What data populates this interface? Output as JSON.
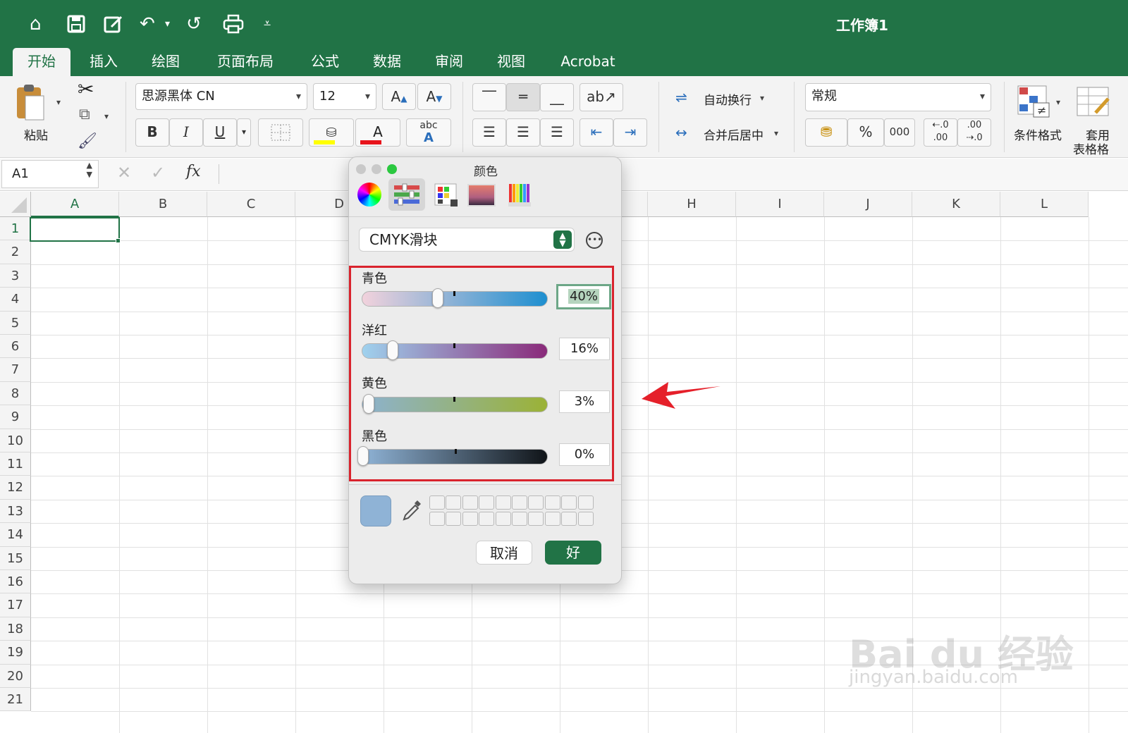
{
  "window": {
    "title": "工作簿1"
  },
  "quick_access": [
    "home-icon",
    "save-icon",
    "edit-save-icon",
    "undo-icon",
    "redo-icon",
    "print-icon",
    "customize-icon"
  ],
  "tabs": [
    {
      "label": "开始",
      "active": true
    },
    {
      "label": "插入"
    },
    {
      "label": "绘图"
    },
    {
      "label": "页面布局"
    },
    {
      "label": "公式"
    },
    {
      "label": "数据"
    },
    {
      "label": "审阅"
    },
    {
      "label": "视图"
    },
    {
      "label": "Acrobat"
    }
  ],
  "ribbon": {
    "paste_label": "粘贴",
    "font_name": "思源黑体 CN",
    "font_size": "12",
    "bold": "B",
    "italic": "I",
    "underline": "U",
    "grow_font": "A",
    "shrink_font": "A",
    "font_color_glyph": "A",
    "phonetic_glyph": "abc",
    "wrap_text": "自动换行",
    "merge_center": "合并后居中",
    "number_format": "常规",
    "percent": "%",
    "thousands": "000",
    "conditional_format": "条件格式",
    "table_format_line1": "套用",
    "table_format_line2": "表格格",
    "colors": {
      "fill_bar": "#ffff00",
      "font_bar": "#e8141c"
    }
  },
  "formula_bar": {
    "name_box": "A1",
    "fx": "fx"
  },
  "grid": {
    "columns": [
      "A",
      "B",
      "C",
      "D",
      "",
      "",
      "",
      "H",
      "I",
      "J",
      "K",
      "L"
    ],
    "rows": [
      "1",
      "2",
      "3",
      "4",
      "5",
      "6",
      "7",
      "8",
      "9",
      "10",
      "11",
      "12",
      "13",
      "14",
      "15",
      "16",
      "17",
      "18",
      "19",
      "20",
      "21"
    ],
    "selected_cell": "A1"
  },
  "dialog": {
    "title": "颜色",
    "mode": "CMYK滑块",
    "sliders": [
      {
        "label": "青色",
        "value": 40,
        "display": "40%"
      },
      {
        "label": "洋红",
        "value": 16,
        "display": "16%"
      },
      {
        "label": "黄色",
        "value": 3,
        "display": "3%"
      },
      {
        "label": "黑色",
        "value": 0,
        "display": "0%"
      }
    ],
    "current_color": "#8fb3d6",
    "cancel_label": "取消",
    "ok_label": "好",
    "highlight_color": "#d9232d",
    "accent_color": "#217346"
  },
  "watermark": {
    "line1": "Bai du 经验",
    "line2": "jingyan.baidu.com"
  }
}
